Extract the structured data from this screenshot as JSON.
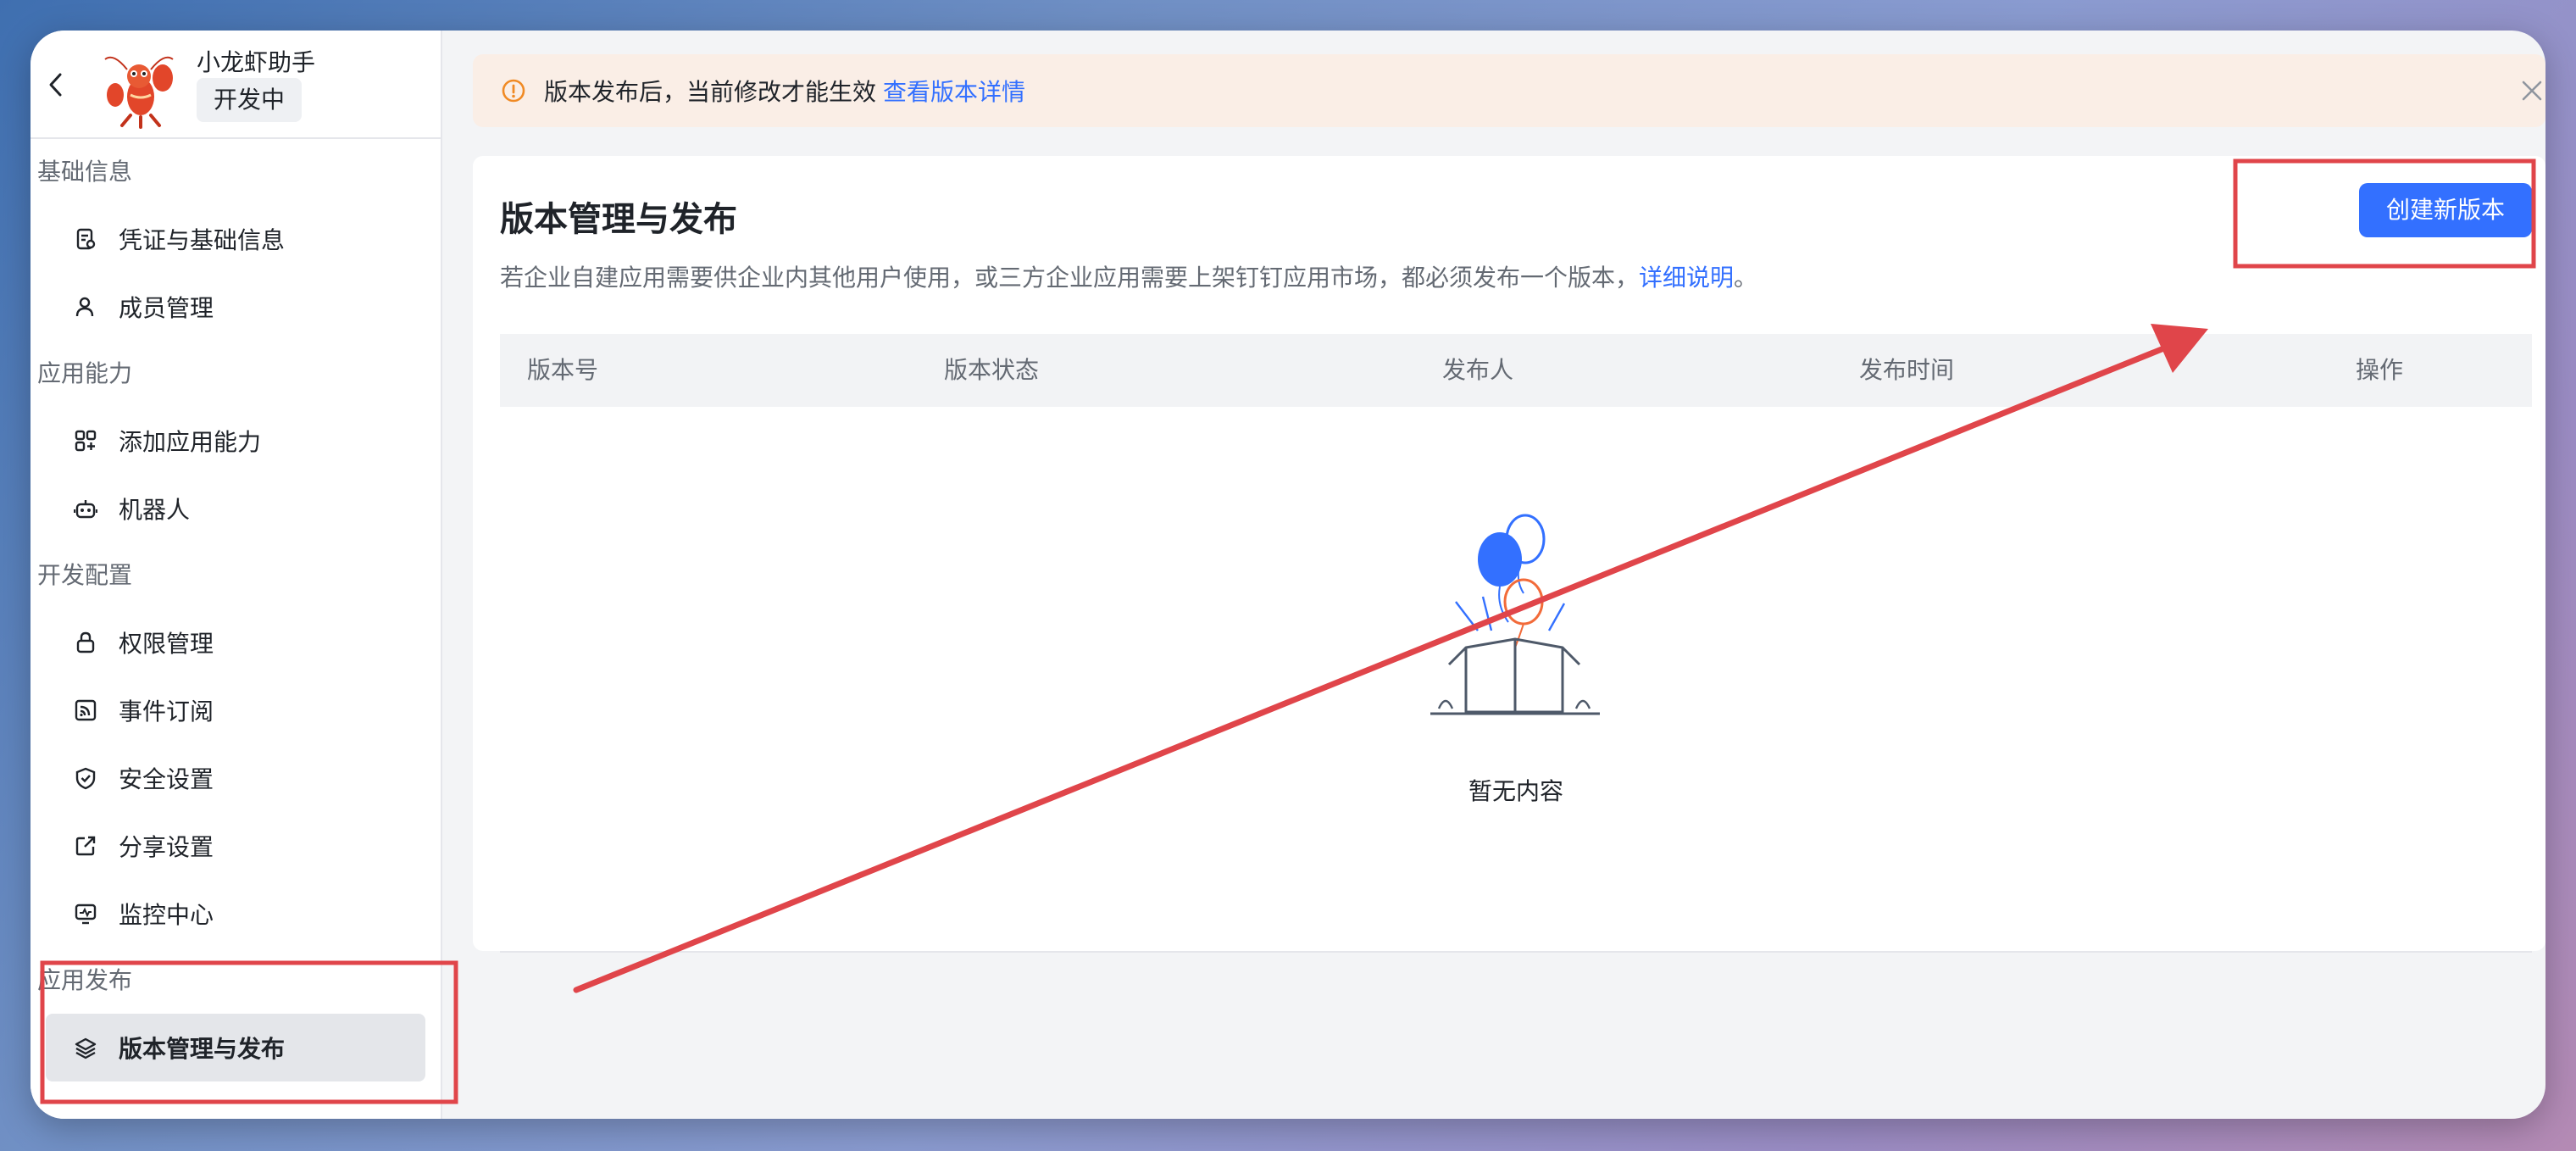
{
  "app": {
    "name": "小龙虾助手",
    "status": "开发中"
  },
  "sidebar": {
    "groups": [
      {
        "title": "基础信息",
        "items": [
          {
            "label": "凭证与基础信息",
            "icon": "credential-icon"
          },
          {
            "label": "成员管理",
            "icon": "user-icon"
          }
        ]
      },
      {
        "title": "应用能力",
        "items": [
          {
            "label": "添加应用能力",
            "icon": "apps-add-icon"
          },
          {
            "label": "机器人",
            "icon": "robot-icon"
          }
        ]
      },
      {
        "title": "开发配置",
        "items": [
          {
            "label": "权限管理",
            "icon": "lock-icon"
          },
          {
            "label": "事件订阅",
            "icon": "rss-icon"
          },
          {
            "label": "安全设置",
            "icon": "shield-icon"
          },
          {
            "label": "分享设置",
            "icon": "share-icon"
          },
          {
            "label": "监控中心",
            "icon": "monitor-icon"
          }
        ]
      },
      {
        "title": "应用发布",
        "items": [
          {
            "label": "版本管理与发布",
            "icon": "layers-icon",
            "active": true
          }
        ]
      }
    ]
  },
  "notice": {
    "text": "版本发布后，当前修改才能生效",
    "link": "查看版本详情"
  },
  "card": {
    "title": "版本管理与发布",
    "description": "若企业自建应用需要供企业内其他用户使用，或三方企业应用需要上架钉钉应用市场，都必须发布一个版本，",
    "description_link": "详细说明",
    "description_end": "。",
    "create_button": "创建新版本"
  },
  "table": {
    "columns": [
      "版本号",
      "版本状态",
      "发布人",
      "发布时间",
      "操作"
    ],
    "empty_text": "暂无内容"
  },
  "colors": {
    "accent": "#3370ff",
    "annotation": "#e0454a",
    "notice_bg": "#faeee6",
    "notice_icon": "#f08a24"
  }
}
